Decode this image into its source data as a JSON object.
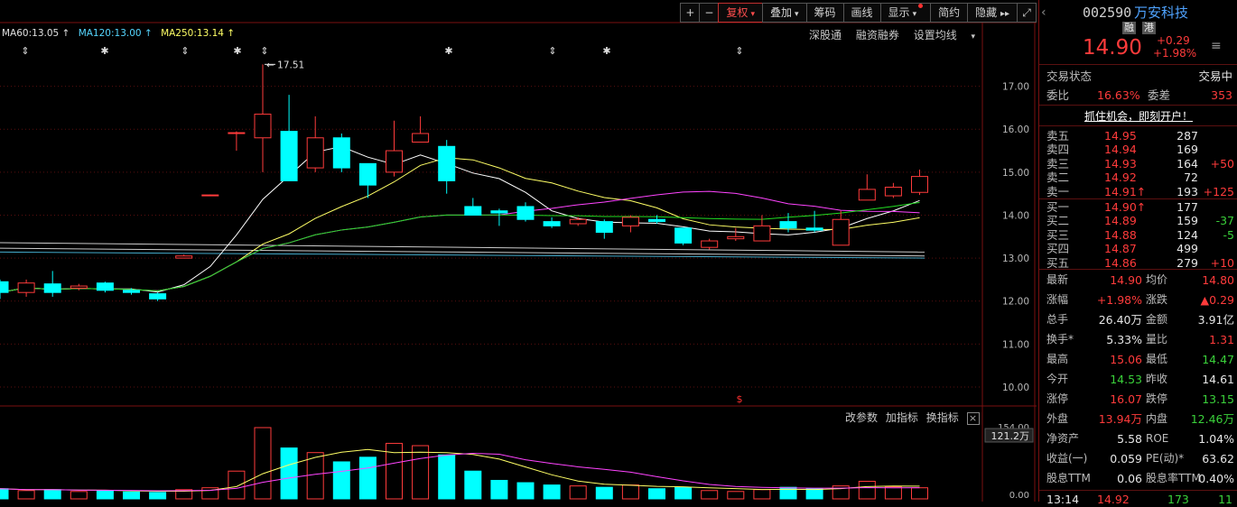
{
  "toolbar": {
    "plus": "+",
    "minus": "−",
    "fuquan": "复权",
    "diejia": "叠加",
    "chouma": "筹码",
    "huaxian": "画线",
    "xianshi": "显示",
    "jianyue": "简约",
    "yincang": "隐藏",
    "next": "▸▸",
    "fullscreen": "⤢"
  },
  "ma_legend": {
    "ma60": "MA60:13.05 ↑",
    "ma120": "MA120:13.00 ↑",
    "ma250": "MA250:13.14 ↑"
  },
  "main_links": [
    "深股通",
    "融资融券",
    "设置均线"
  ],
  "indicator_links": [
    "改参数",
    "加指标",
    "换指标"
  ],
  "annotations": {
    "high_label": "17.51",
    "marker": "$"
  },
  "colors": {
    "up": "#ff3b3b",
    "down": "#00ffff",
    "ma5": "#ffffff",
    "ma10": "#ffff66",
    "ma20": "#ff44ff",
    "ma60": "#22dd22"
  },
  "chart_data": {
    "type": "candlestick",
    "price_axis": {
      "ylim": [
        9.6,
        18.0
      ],
      "ticks": [
        "17.00",
        "16.00",
        "15.00",
        "14.00",
        "13.00",
        "12.00",
        "11.00",
        "10.00"
      ]
    },
    "volume_axis": {
      "ticks": [
        "154.00",
        "0.00"
      ],
      "label": "121.2万"
    },
    "candles": [
      {
        "o": 12.45,
        "c": 12.2,
        "h": 12.5,
        "l": 12.05
      },
      {
        "o": 12.2,
        "c": 12.42,
        "h": 12.5,
        "l": 12.1
      },
      {
        "o": 12.4,
        "c": 12.2,
        "h": 12.7,
        "l": 12.1
      },
      {
        "o": 12.3,
        "c": 12.35,
        "h": 12.4,
        "l": 12.25
      },
      {
        "o": 12.42,
        "c": 12.25,
        "h": 12.45,
        "l": 12.2
      },
      {
        "o": 12.25,
        "c": 12.2,
        "h": 12.3,
        "l": 12.15
      },
      {
        "o": 12.17,
        "c": 12.05,
        "h": 12.2,
        "l": 12.0
      },
      {
        "o": 13.0,
        "c": 13.05,
        "h": 13.08,
        "l": 13.0
      },
      {
        "o": 14.45,
        "c": 14.47,
        "h": 14.48,
        "l": 14.45
      },
      {
        "o": 15.9,
        "c": 15.92,
        "h": 15.95,
        "l": 15.5
      },
      {
        "o": 15.8,
        "c": 16.35,
        "h": 17.51,
        "l": 15.0
      },
      {
        "o": 15.95,
        "c": 14.8,
        "h": 16.8,
        "l": 14.8
      },
      {
        "o": 15.1,
        "c": 15.8,
        "h": 16.3,
        "l": 15.0
      },
      {
        "o": 15.8,
        "c": 15.1,
        "h": 15.9,
        "l": 15.0
      },
      {
        "o": 15.2,
        "c": 14.7,
        "h": 15.2,
        "l": 14.4
      },
      {
        "o": 15.0,
        "c": 15.5,
        "h": 16.2,
        "l": 14.9
      },
      {
        "o": 15.7,
        "c": 15.9,
        "h": 16.3,
        "l": 15.7
      },
      {
        "o": 15.6,
        "c": 14.8,
        "h": 15.75,
        "l": 14.5
      },
      {
        "o": 14.2,
        "c": 14.0,
        "h": 14.4,
        "l": 14.0
      },
      {
        "o": 14.1,
        "c": 14.05,
        "h": 14.15,
        "l": 13.75
      },
      {
        "o": 14.2,
        "c": 13.9,
        "h": 14.3,
        "l": 13.85
      },
      {
        "o": 13.85,
        "c": 13.75,
        "h": 13.95,
        "l": 13.7
      },
      {
        "o": 13.8,
        "c": 13.9,
        "h": 13.95,
        "l": 13.75
      },
      {
        "o": 13.85,
        "c": 13.6,
        "h": 13.9,
        "l": 13.45
      },
      {
        "o": 13.75,
        "c": 13.95,
        "h": 14.0,
        "l": 13.6
      },
      {
        "o": 13.9,
        "c": 13.85,
        "h": 14.0,
        "l": 13.8
      },
      {
        "o": 13.7,
        "c": 13.35,
        "h": 13.7,
        "l": 13.3
      },
      {
        "o": 13.25,
        "c": 13.4,
        "h": 13.45,
        "l": 13.2
      },
      {
        "o": 13.45,
        "c": 13.5,
        "h": 13.7,
        "l": 13.4
      },
      {
        "o": 13.4,
        "c": 13.75,
        "h": 14.0,
        "l": 13.4
      },
      {
        "o": 13.85,
        "c": 13.7,
        "h": 14.05,
        "l": 13.6
      },
      {
        "o": 13.7,
        "c": 13.65,
        "h": 14.1,
        "l": 13.6
      },
      {
        "o": 13.3,
        "c": 13.9,
        "h": 14.1,
        "l": 13.3
      },
      {
        "o": 14.35,
        "c": 14.6,
        "h": 14.95,
        "l": 14.35
      },
      {
        "o": 14.45,
        "c": 14.65,
        "h": 14.75,
        "l": 14.4
      },
      {
        "o": 14.53,
        "c": 14.9,
        "h": 15.06,
        "l": 14.47
      }
    ],
    "volumes": [
      22,
      18,
      20,
      16,
      18,
      15,
      14,
      20,
      24,
      60,
      154,
      110,
      100,
      80,
      90,
      120,
      115,
      95,
      60,
      40,
      35,
      30,
      28,
      25,
      30,
      22,
      25,
      18,
      16,
      20,
      25,
      22,
      28,
      38,
      26,
      24
    ]
  },
  "panel": {
    "code": "002590",
    "name": "万安科技",
    "badges": [
      "融",
      "港"
    ],
    "price": "14.90",
    "change": "+0.29",
    "change_pct": "+1.98%",
    "status_label": "交易状态",
    "status_value": "交易中",
    "weibi_label": "委比",
    "weibi_value": "16.63%",
    "weicha_label": "委差",
    "weicha_value": "353",
    "promo": "抓住机会，即刻开户！",
    "asks": [
      {
        "label": "卖五",
        "price": "14.95",
        "vol": "287",
        "delta": ""
      },
      {
        "label": "卖四",
        "price": "14.94",
        "vol": "169",
        "delta": ""
      },
      {
        "label": "卖三",
        "price": "14.93",
        "vol": "164",
        "delta": "+50"
      },
      {
        "label": "卖二",
        "price": "14.92",
        "vol": "72",
        "delta": ""
      },
      {
        "label": "卖一",
        "price": "14.91↑",
        "vol": "193",
        "delta": "+125"
      }
    ],
    "bids": [
      {
        "label": "买一",
        "price": "14.90↑",
        "vol": "177",
        "delta": ""
      },
      {
        "label": "买二",
        "price": "14.89",
        "vol": "159",
        "delta": "-37"
      },
      {
        "label": "买三",
        "price": "14.88",
        "vol": "124",
        "delta": "-5"
      },
      {
        "label": "买四",
        "price": "14.87",
        "vol": "499",
        "delta": ""
      },
      {
        "label": "买五",
        "price": "14.86",
        "vol": "279",
        "delta": "+10"
      }
    ],
    "stats": [
      {
        "l1": "最新",
        "v1": "14.90",
        "c1": "red",
        "l2": "均价",
        "v2": "14.80",
        "c2": "red"
      },
      {
        "l1": "涨幅",
        "v1": "+1.98%",
        "c1": "red",
        "l2": "涨跌",
        "v2": "▲0.29",
        "c2": "red"
      },
      {
        "l1": "总手",
        "v1": "26.40万",
        "c1": "white",
        "l2": "金额",
        "v2": "3.91亿",
        "c2": "white"
      },
      {
        "l1": "换手*",
        "v1": "5.33%",
        "c1": "white",
        "l2": "量比",
        "v2": "1.31",
        "c2": "red"
      },
      {
        "l1": "最高",
        "v1": "15.06",
        "c1": "red",
        "l2": "最低",
        "v2": "14.47",
        "c2": "green"
      },
      {
        "l1": "今开",
        "v1": "14.53",
        "c1": "green",
        "l2": "昨收",
        "v2": "14.61",
        "c2": "white"
      },
      {
        "l1": "涨停",
        "v1": "16.07",
        "c1": "red",
        "l2": "跌停",
        "v2": "13.15",
        "c2": "green"
      },
      {
        "l1": "外盘",
        "v1": "13.94万",
        "c1": "red",
        "l2": "内盘",
        "v2": "12.46万",
        "c2": "green"
      },
      {
        "l1": "净资产",
        "v1": "5.58",
        "c1": "white",
        "l2": "ROE",
        "v2": "1.04%",
        "c2": "white"
      },
      {
        "l1": "收益(一)",
        "v1": "0.059",
        "c1": "white",
        "l2": "PE(动)*",
        "v2": "63.62",
        "c2": "white"
      },
      {
        "l1": "股息TTM",
        "v1": "0.06",
        "c1": "white",
        "l2": "股息率TTM",
        "v2": "0.40%",
        "c2": "white"
      }
    ],
    "tick": {
      "time": "13:14",
      "price": "14.92",
      "vol": "173",
      "n": "11"
    }
  }
}
